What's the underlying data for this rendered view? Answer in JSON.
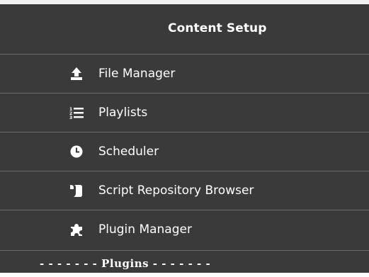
{
  "menu": {
    "header": "Content Setup",
    "items": [
      {
        "label": "File Manager",
        "icon": "upload-icon"
      },
      {
        "label": "Playlists",
        "icon": "list-icon"
      },
      {
        "label": "Scheduler",
        "icon": "clock-icon"
      },
      {
        "label": "Script Repository Browser",
        "icon": "scroll-icon"
      },
      {
        "label": "Plugin Manager",
        "icon": "puzzle-icon"
      }
    ],
    "divider": "- - - - - - - Plugins - - - - - - -"
  },
  "colors": {
    "background": "#3a3a3a",
    "text": "#ffffff",
    "separator": "#6b6b6b"
  }
}
